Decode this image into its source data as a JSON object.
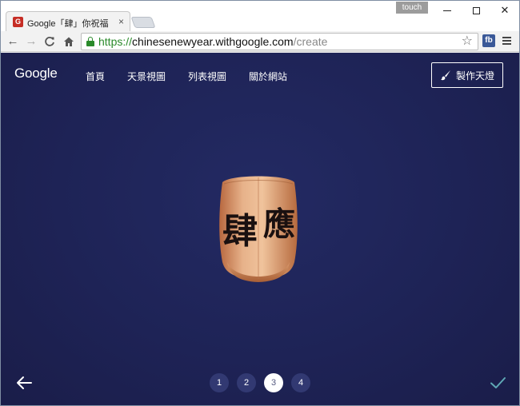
{
  "browser": {
    "tab_title": "Google「肆」你祝福",
    "tab_favicon": "G",
    "tab_close": "×",
    "touch_label": "touch",
    "url_scheme": "https://",
    "url_host": "chinesenewyear.withgoogle.com",
    "url_path": "/create",
    "extension_label": "fb",
    "icons": [
      "back-icon",
      "forward-icon",
      "reload-icon",
      "home-icon",
      "lock-icon",
      "star-icon",
      "menu-icon"
    ]
  },
  "site": {
    "logo": "Google",
    "nav": [
      "首頁",
      "天景視圖",
      "列表視圖",
      "關於網站"
    ],
    "make_button": "製作天燈",
    "lantern_chars": [
      "肆",
      "應"
    ],
    "steps": [
      "1",
      "2",
      "3",
      "4"
    ],
    "active_step": "3",
    "colors": {
      "background": "#1e2356",
      "step_inactive": "#323972",
      "step_active": "#ffffff",
      "check": "#5fa8b5",
      "lantern": "#d9986a"
    }
  }
}
